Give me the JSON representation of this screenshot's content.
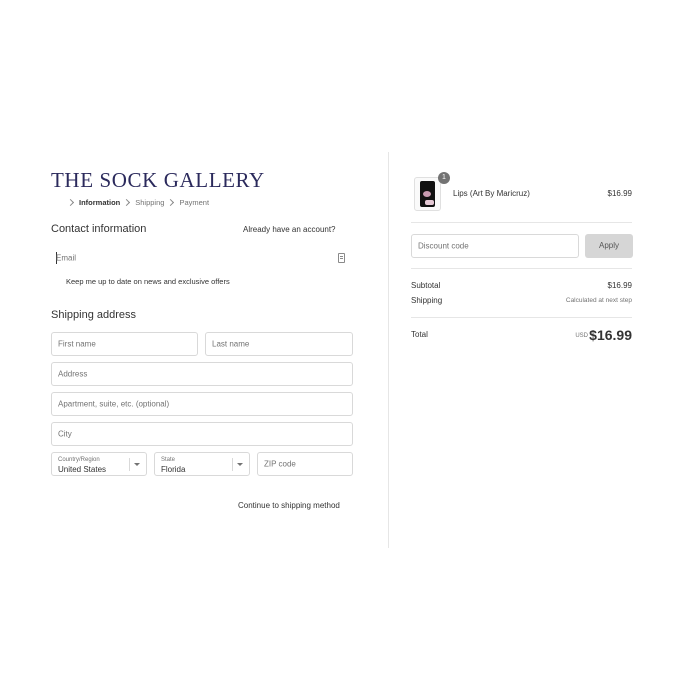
{
  "store": {
    "logo_text": "THE SOCK GALLERY"
  },
  "breadcrumb": {
    "items": [
      "Information",
      "Shipping",
      "Payment"
    ]
  },
  "contact": {
    "heading": "Contact information",
    "login_link": "Already have an account?",
    "email_placeholder": "Email",
    "offers_label": "Keep me up to date on news and exclusive offers"
  },
  "shipping": {
    "heading": "Shipping address",
    "first_name_placeholder": "First name",
    "last_name_placeholder": "Last name",
    "address_placeholder": "Address",
    "apartment_placeholder": "Apartment, suite, etc. (optional)",
    "city_placeholder": "City",
    "country_label": "Country/Region",
    "country_value": "United States",
    "state_label": "State",
    "state_value": "Florida",
    "zip_placeholder": "ZIP code",
    "continue_label": "Continue to shipping method"
  },
  "cart": {
    "items": [
      {
        "name": "Lips (Art By Maricruz)",
        "quantity": "1",
        "price": "$16.99"
      }
    ],
    "discount_placeholder": "Discount code",
    "apply_label": "Apply",
    "subtotal_label": "Subtotal",
    "subtotal_value": "$16.99",
    "shipping_label": "Shipping",
    "shipping_value": "Calculated at next step",
    "total_label": "Total",
    "currency": "USD",
    "total_value": "$16.99"
  },
  "colors": {
    "brand": "#2b2a5c",
    "border": "#d9d9d9",
    "apply_bg": "#d6d6d6"
  }
}
